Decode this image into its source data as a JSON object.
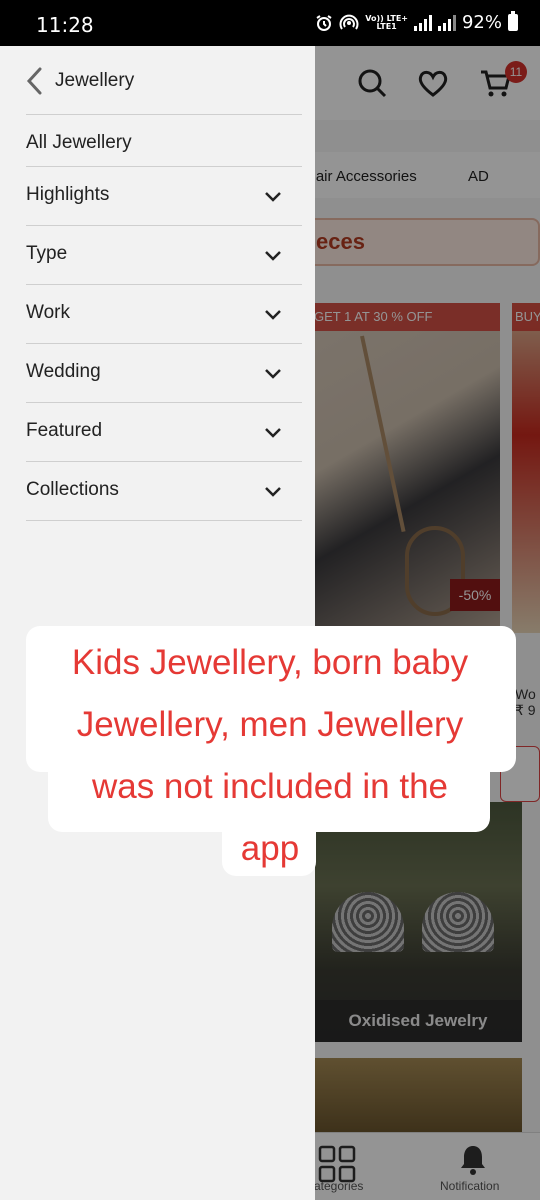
{
  "status_bar": {
    "time": "11:28",
    "volte_label": "Vo)) LTE+",
    "lte1_label": "LTE1",
    "battery": "92%"
  },
  "app": {
    "cart_count": "11",
    "categories": [
      "Hair Accessories",
      "AD"
    ],
    "banner_text": "eces",
    "product_offer": "GET 1 AT 30 % OFF",
    "product_offer2": "BUY",
    "discount": "-50%",
    "side_title_fragment": "Wo",
    "side_price_fragment": "₹ 9",
    "jewel_caption": "Oxidised Jewelry",
    "nav": {
      "categories_label": "ategories",
      "notification_label": "Notification"
    }
  },
  "drawer": {
    "title": "Jewellery",
    "all_label": "All Jewellery",
    "items": [
      {
        "label": "Highlights"
      },
      {
        "label": "Type"
      },
      {
        "label": "Work"
      },
      {
        "label": "Wedding"
      },
      {
        "label": "Featured"
      },
      {
        "label": "Collections"
      }
    ]
  },
  "annotation": {
    "lines": [
      "Kids Jewellery,  born baby",
      "Jewellery,  men Jewellery",
      "was not included in the",
      "app"
    ],
    "color": "#e53935"
  },
  "colors": {
    "accent": "#d4312b",
    "drawer_bg": "#f2f2f2"
  }
}
